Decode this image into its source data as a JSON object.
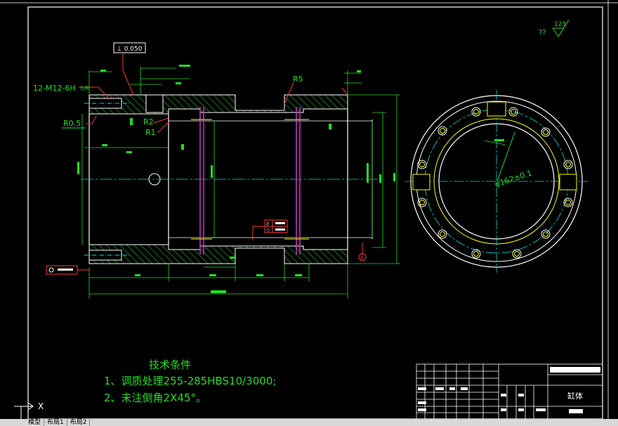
{
  "annotations": {
    "flatness_box": "⊥ 0.050",
    "thread_callout": "12-M12-6H",
    "thread_suffix": "均布",
    "r5": "R5",
    "r05": "R0.5",
    "r2": "R2",
    "r1": "R1",
    "roughness_mark": "??",
    "roughness_value": "125",
    "diameter_callout": "φ162±0.1",
    "datum_a": "A",
    "parallel_sym": "//",
    "circle_sym": "○"
  },
  "tech": {
    "title": "技术条件",
    "line1": "1、调质处理255-285HBS10/3000;",
    "line2": "2、未注倒角2X45°。"
  },
  "title_block": {
    "part_name": "缸体"
  },
  "ucs": {
    "label": "X"
  },
  "tabs": [
    "模型",
    "布局1",
    "布局2"
  ],
  "colors": {
    "background": "#000000",
    "outline": "#ffffff",
    "dimension": "#22dd22",
    "section": "#ffff00",
    "hatch": "#22dd22",
    "center": "#00dddd",
    "magenta": "#cc33cc",
    "red": "#ff3333"
  }
}
